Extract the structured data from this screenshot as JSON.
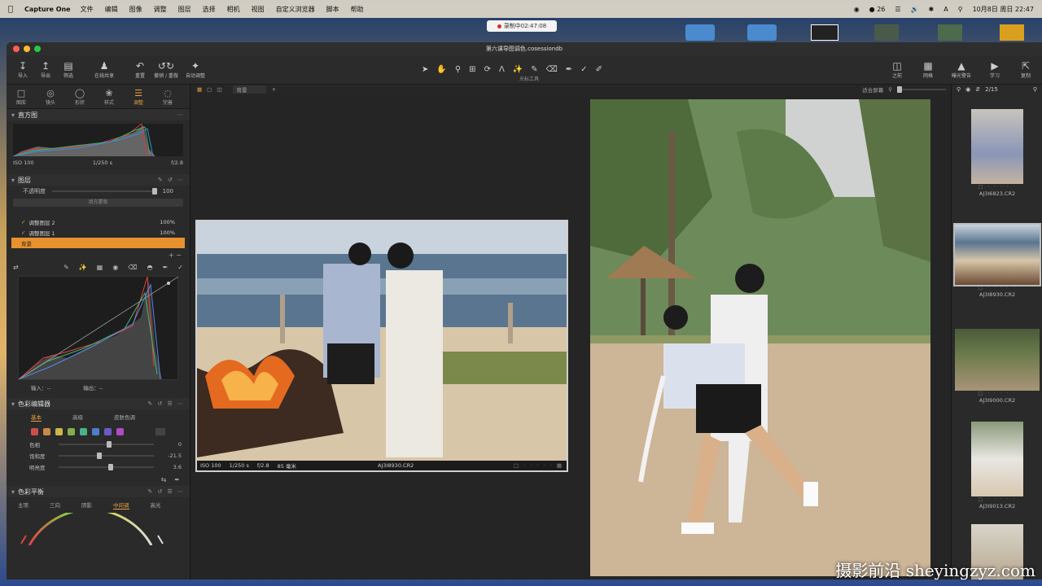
{
  "menubar": {
    "app_name": "Capture One",
    "items": [
      "文件",
      "编辑",
      "图像",
      "调整",
      "图层",
      "选择",
      "相机",
      "视图",
      "自定义浏览器",
      "脚本",
      "帮助"
    ],
    "battery": "26",
    "datetime": "10月8日 周日 22:47"
  },
  "recording": {
    "label": "录制中02:47:08"
  },
  "window": {
    "title": "第六课导图调色.cosessiondb"
  },
  "toolbar": {
    "left": [
      {
        "label": "导入",
        "icon": "import-icon"
      },
      {
        "label": "导出",
        "icon": "export-icon"
      },
      {
        "label": "筛选",
        "icon": "filter-icon"
      },
      {
        "label": "在线共享",
        "icon": "share-icon"
      },
      {
        "label": "重置",
        "icon": "reset-icon"
      },
      {
        "label": "撤销 / 重做",
        "icon": "undo-icon"
      },
      {
        "label": "自动调整",
        "icon": "auto-adjust-icon"
      }
    ],
    "center_label": "光标工具",
    "right": [
      {
        "label": "之前",
        "icon": "before-icon"
      },
      {
        "label": "网格",
        "icon": "grid-icon"
      },
      {
        "label": "曝光警告",
        "icon": "warning-icon"
      },
      {
        "label": "学习",
        "icon": "learn-icon"
      },
      {
        "label": "复制",
        "icon": "copy-icon"
      }
    ]
  },
  "tool_tabs": [
    {
      "label": "图库",
      "icon": "library-icon"
    },
    {
      "label": "镜头",
      "icon": "lens-icon"
    },
    {
      "label": "形状",
      "icon": "shape-icon"
    },
    {
      "label": "样式",
      "icon": "style-icon"
    },
    {
      "label": "调整",
      "icon": "adjust-icon",
      "active": true
    },
    {
      "label": "完善",
      "icon": "refine-icon"
    }
  ],
  "histogram": {
    "title": "直方图",
    "iso": "ISO 100",
    "shutter": "1/250 s",
    "aperture": "f/2.8"
  },
  "layers": {
    "title": "图层",
    "opacity_label": "不透明度",
    "opacity_value": "100",
    "fill_button": "填充蒙版",
    "items": [
      {
        "name": "调整图层 2",
        "pct": "100%"
      },
      {
        "name": "调整图层 1",
        "pct": "100%"
      },
      {
        "name": "背景",
        "pct": "",
        "selected": true
      }
    ]
  },
  "curve": {
    "input_label": "输入：",
    "input_value": "--",
    "output_label": "输出：",
    "output_value": "--"
  },
  "color_editor": {
    "title": "色彩编辑器",
    "tabs": [
      "基本",
      "高级",
      "皮肤色调"
    ],
    "swatches": [
      "#c9504a",
      "#c9884a",
      "#c9b84a",
      "#7fb04a",
      "#4ab08a",
      "#4a80c9",
      "#6a5ac9",
      "#b04ac9"
    ],
    "sliders": [
      {
        "label": "色相",
        "value": "0",
        "pos": 0.5
      },
      {
        "label": "饱和度",
        "value": "-21.5",
        "pos": 0.4
      },
      {
        "label": "明亮度",
        "value": "3.6",
        "pos": 0.52
      }
    ]
  },
  "color_balance": {
    "title": "色彩平衡",
    "tabs": [
      "主项",
      "三向",
      "阴影",
      "中间调",
      "高光"
    ],
    "active_tab": "中间调"
  },
  "viewer_bar": {
    "layer_select": "背景",
    "fit_label": "适合屏幕",
    "count": "2/15"
  },
  "small_photo_info": {
    "iso": "ISO 100",
    "shutter": "1/250 s",
    "aperture": "f/2.8",
    "focal": "85 毫米",
    "filename": "AJ3I8930.CR2"
  },
  "browser": {
    "thumbs": [
      {
        "name": "AJ3I6823.CR2"
      },
      {
        "name": "AJ3I8930.CR2",
        "selected": true
      },
      {
        "name": "AJ3I9000.CR2"
      },
      {
        "name": "AJ3I9013.CR2"
      }
    ]
  },
  "watermark": {
    "text": "摄影前沿 sheyingzyz.com"
  }
}
